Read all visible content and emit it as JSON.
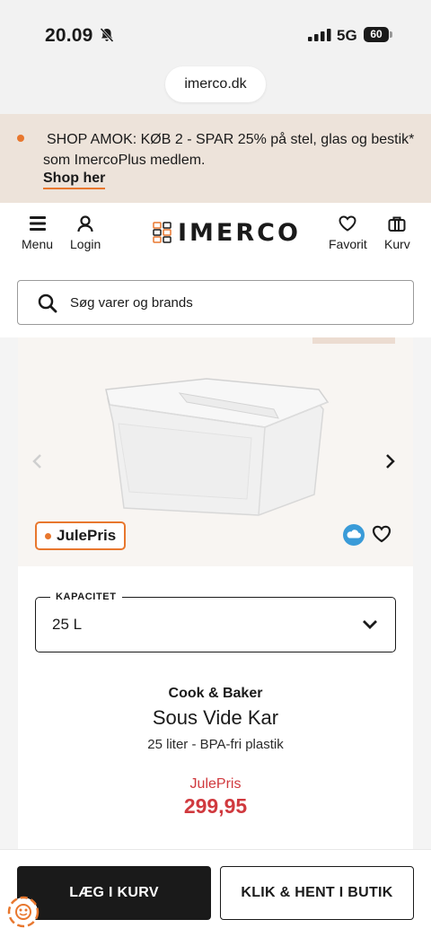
{
  "status_bar": {
    "time": "20.09",
    "network": "5G",
    "battery": "60"
  },
  "browser": {
    "url": "imerco.dk"
  },
  "promo": {
    "text_line1": "SHOP AMOK: KØB 2 - SPAR 25% på stel, glas og bestik*",
    "text_line2": "som ImercoPlus medlem.",
    "link": "Shop her",
    "accent_color": "#e8772e"
  },
  "header": {
    "menu_label": "Menu",
    "login_label": "Login",
    "logo_text": "IMERCO",
    "favorites_label": "Favorit",
    "cart_label": "Kurv"
  },
  "search": {
    "placeholder": "Søg varer og brands"
  },
  "product": {
    "badge": "JulePris",
    "capacity_label": "KAPACITET",
    "capacity_value": "25 L",
    "brand": "Cook & Baker",
    "name": "Sous Vide Kar",
    "description": "25 liter - BPA-fri plastik",
    "price_label": "JulePris",
    "price": "299,95",
    "price_color": "#d0393e"
  },
  "actions": {
    "add_to_cart": "LÆG I KURV",
    "click_collect": "KLIK & HENT I BUTIK"
  }
}
